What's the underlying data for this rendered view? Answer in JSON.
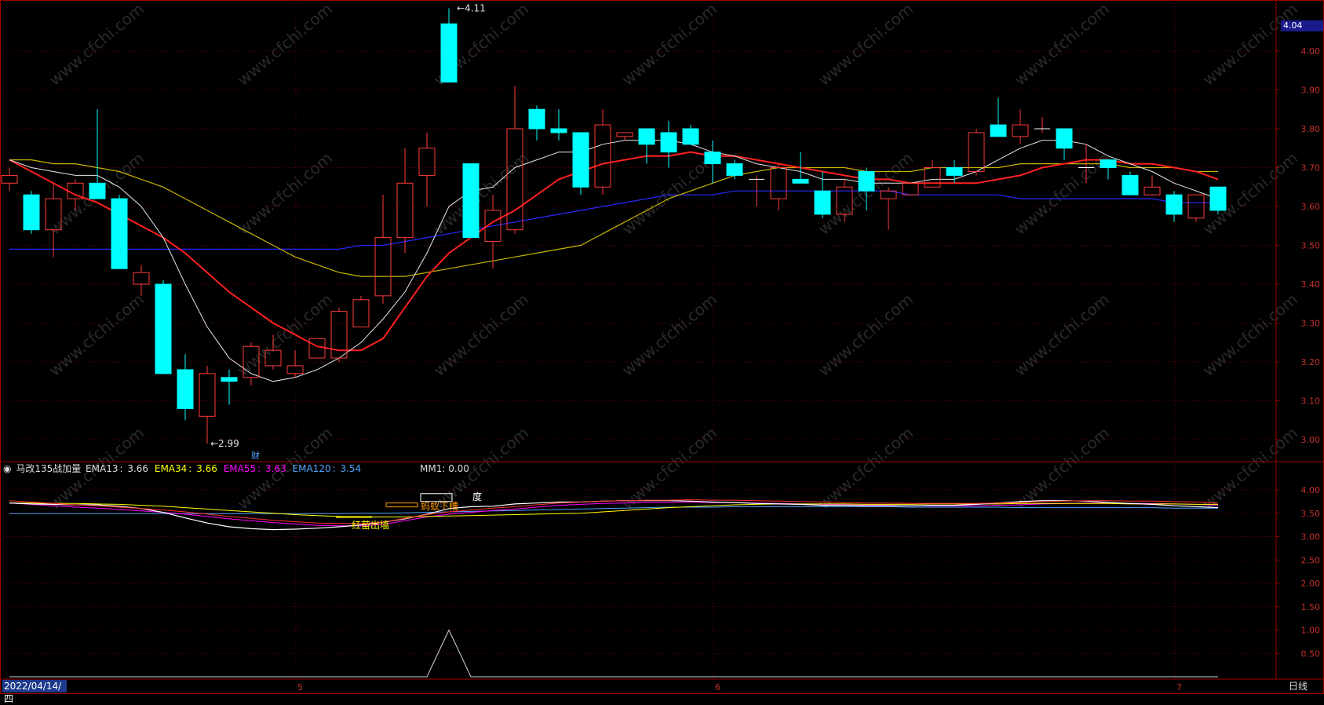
{
  "chart_data": {
    "type": "candlestick",
    "main_panel": {
      "y_ticks": [
        "4.00",
        "3.90",
        "3.80",
        "3.70",
        "3.60",
        "3.50",
        "3.40",
        "3.30",
        "3.20",
        "3.10",
        "3.00"
      ],
      "ylim": [
        2.95,
        4.12
      ],
      "current_price_tag": "4.04",
      "high_label": "4.11",
      "low_label": "2.99",
      "marker_label": "财",
      "candles": [
        {
          "o": 3.66,
          "h": 3.7,
          "l": 3.64,
          "c": 3.68
        },
        {
          "o": 3.63,
          "h": 3.64,
          "l": 3.53,
          "c": 3.54
        },
        {
          "o": 3.54,
          "h": 3.66,
          "l": 3.47,
          "c": 3.62
        },
        {
          "o": 3.62,
          "h": 3.67,
          "l": 3.59,
          "c": 3.66
        },
        {
          "o": 3.66,
          "h": 3.85,
          "l": 3.62,
          "c": 3.62
        },
        {
          "o": 3.62,
          "h": 3.63,
          "l": 3.44,
          "c": 3.44
        },
        {
          "o": 3.4,
          "h": 3.45,
          "l": 3.37,
          "c": 3.43
        },
        {
          "o": 3.4,
          "h": 3.41,
          "l": 3.17,
          "c": 3.17
        },
        {
          "o": 3.18,
          "h": 3.22,
          "l": 3.05,
          "c": 3.08
        },
        {
          "o": 3.06,
          "h": 3.19,
          "l": 2.99,
          "c": 3.17
        },
        {
          "o": 3.16,
          "h": 3.18,
          "l": 3.09,
          "c": 3.15
        },
        {
          "o": 3.16,
          "h": 3.25,
          "l": 3.14,
          "c": 3.24
        },
        {
          "o": 3.19,
          "h": 3.27,
          "l": 3.18,
          "c": 3.23
        },
        {
          "o": 3.17,
          "h": 3.23,
          "l": 3.16,
          "c": 3.19
        },
        {
          "o": 3.21,
          "h": 3.26,
          "l": 3.21,
          "c": 3.26
        },
        {
          "o": 3.21,
          "h": 3.34,
          "l": 3.2,
          "c": 3.33
        },
        {
          "o": 3.29,
          "h": 3.37,
          "l": 3.29,
          "c": 3.36
        },
        {
          "o": 3.37,
          "h": 3.63,
          "l": 3.35,
          "c": 3.52
        },
        {
          "o": 3.52,
          "h": 3.75,
          "l": 3.48,
          "c": 3.66
        },
        {
          "o": 3.68,
          "h": 3.79,
          "l": 3.6,
          "c": 3.75
        },
        {
          "o": 4.07,
          "h": 4.11,
          "l": 3.92,
          "c": 3.92
        },
        {
          "o": 3.71,
          "h": 3.71,
          "l": 3.52,
          "c": 3.52
        },
        {
          "o": 3.51,
          "h": 3.63,
          "l": 3.44,
          "c": 3.59
        },
        {
          "o": 3.54,
          "h": 3.91,
          "l": 3.53,
          "c": 3.8
        },
        {
          "o": 3.85,
          "h": 3.86,
          "l": 3.77,
          "c": 3.8
        },
        {
          "o": 3.8,
          "h": 3.85,
          "l": 3.77,
          "c": 3.79
        },
        {
          "o": 3.79,
          "h": 3.79,
          "l": 3.63,
          "c": 3.65
        },
        {
          "o": 3.65,
          "h": 3.85,
          "l": 3.63,
          "c": 3.81
        },
        {
          "o": 3.78,
          "h": 3.79,
          "l": 3.77,
          "c": 3.79
        },
        {
          "o": 3.8,
          "h": 3.8,
          "l": 3.71,
          "c": 3.76
        },
        {
          "o": 3.79,
          "h": 3.82,
          "l": 3.7,
          "c": 3.74
        },
        {
          "o": 3.8,
          "h": 3.81,
          "l": 3.77,
          "c": 3.76
        },
        {
          "o": 3.74,
          "h": 3.77,
          "l": 3.66,
          "c": 3.71
        },
        {
          "o": 3.71,
          "h": 3.72,
          "l": 3.67,
          "c": 3.68
        },
        {
          "o": 3.67,
          "h": 3.68,
          "l": 3.6,
          "c": 3.67
        },
        {
          "o": 3.62,
          "h": 3.71,
          "l": 3.59,
          "c": 3.7
        },
        {
          "o": 3.67,
          "h": 3.74,
          "l": 3.66,
          "c": 3.66
        },
        {
          "o": 3.64,
          "h": 3.69,
          "l": 3.57,
          "c": 3.58
        },
        {
          "o": 3.58,
          "h": 3.67,
          "l": 3.56,
          "c": 3.65
        },
        {
          "o": 3.69,
          "h": 3.7,
          "l": 3.59,
          "c": 3.64
        },
        {
          "o": 3.62,
          "h": 3.65,
          "l": 3.54,
          "c": 3.64
        },
        {
          "o": 3.63,
          "h": 3.66,
          "l": 3.63,
          "c": 3.66
        },
        {
          "o": 3.65,
          "h": 3.72,
          "l": 3.65,
          "c": 3.7
        },
        {
          "o": 3.7,
          "h": 3.72,
          "l": 3.66,
          "c": 3.68
        },
        {
          "o": 3.69,
          "h": 3.8,
          "l": 3.68,
          "c": 3.79
        },
        {
          "o": 3.81,
          "h": 3.88,
          "l": 3.78,
          "c": 3.78
        },
        {
          "o": 3.78,
          "h": 3.85,
          "l": 3.76,
          "c": 3.81
        },
        {
          "o": 3.8,
          "h": 3.83,
          "l": 3.79,
          "c": 3.8
        },
        {
          "o": 3.8,
          "h": 3.8,
          "l": 3.72,
          "c": 3.75
        },
        {
          "o": 3.7,
          "h": 3.76,
          "l": 3.66,
          "c": 3.7
        },
        {
          "o": 3.72,
          "h": 3.72,
          "l": 3.67,
          "c": 3.7
        },
        {
          "o": 3.68,
          "h": 3.69,
          "l": 3.63,
          "c": 3.63
        },
        {
          "o": 3.63,
          "h": 3.68,
          "l": 3.63,
          "c": 3.65
        },
        {
          "o": 3.63,
          "h": 3.64,
          "l": 3.56,
          "c": 3.58
        },
        {
          "o": 3.57,
          "h": 3.63,
          "l": 3.56,
          "c": 3.63
        },
        {
          "o": 3.65,
          "h": 3.65,
          "l": 3.58,
          "c": 3.59
        }
      ],
      "ema13": [
        3.72,
        3.7,
        3.69,
        3.68,
        3.68,
        3.65,
        3.6,
        3.52,
        3.4,
        3.29,
        3.21,
        3.17,
        3.15,
        3.16,
        3.18,
        3.21,
        3.25,
        3.31,
        3.38,
        3.48,
        3.6,
        3.64,
        3.65,
        3.7,
        3.72,
        3.74,
        3.74,
        3.76,
        3.77,
        3.77,
        3.77,
        3.76,
        3.74,
        3.73,
        3.71,
        3.7,
        3.69,
        3.67,
        3.67,
        3.66,
        3.66,
        3.66,
        3.67,
        3.67,
        3.69,
        3.72,
        3.75,
        3.77,
        3.77,
        3.76,
        3.73,
        3.71,
        3.69,
        3.66,
        3.64,
        3.62
      ],
      "ema34": [
        3.72,
        3.72,
        3.71,
        3.71,
        3.7,
        3.69,
        3.67,
        3.65,
        3.62,
        3.59,
        3.56,
        3.53,
        3.5,
        3.47,
        3.45,
        3.43,
        3.42,
        3.42,
        3.42,
        3.43,
        3.44,
        3.45,
        3.46,
        3.47,
        3.48,
        3.49,
        3.5,
        3.53,
        3.56,
        3.59,
        3.62,
        3.64,
        3.66,
        3.68,
        3.69,
        3.7,
        3.7,
        3.7,
        3.7,
        3.69,
        3.69,
        3.69,
        3.7,
        3.7,
        3.7,
        3.7,
        3.71,
        3.71,
        3.71,
        3.71,
        3.71,
        3.7,
        3.7,
        3.7,
        3.69,
        3.69
      ],
      "ema55": [
        3.72,
        3.69,
        3.66,
        3.63,
        3.61,
        3.58,
        3.55,
        3.52,
        3.48,
        3.43,
        3.38,
        3.34,
        3.3,
        3.27,
        3.24,
        3.23,
        3.23,
        3.26,
        3.34,
        3.42,
        3.48,
        3.52,
        3.56,
        3.59,
        3.63,
        3.67,
        3.69,
        3.71,
        3.72,
        3.73,
        3.73,
        3.74,
        3.73,
        3.73,
        3.72,
        3.71,
        3.7,
        3.69,
        3.68,
        3.67,
        3.67,
        3.66,
        3.66,
        3.66,
        3.66,
        3.67,
        3.68,
        3.7,
        3.71,
        3.72,
        3.72,
        3.71,
        3.71,
        3.7,
        3.69,
        3.67
      ],
      "ema120": [
        3.49,
        3.49,
        3.49,
        3.49,
        3.49,
        3.49,
        3.49,
        3.49,
        3.49,
        3.49,
        3.49,
        3.49,
        3.49,
        3.49,
        3.49,
        3.49,
        3.5,
        3.5,
        3.51,
        3.52,
        3.53,
        3.54,
        3.55,
        3.56,
        3.57,
        3.58,
        3.59,
        3.6,
        3.61,
        3.62,
        3.63,
        3.63,
        3.63,
        3.64,
        3.64,
        3.64,
        3.64,
        3.64,
        3.64,
        3.64,
        3.64,
        3.63,
        3.63,
        3.63,
        3.63,
        3.63,
        3.62,
        3.62,
        3.62,
        3.62,
        3.62,
        3.62,
        3.62,
        3.61,
        3.61,
        3.61
      ]
    },
    "indicator_panel": {
      "title": "马改135战加量",
      "legend": [
        {
          "name": "EMA13",
          "value": "3.66",
          "color": "#ffffff"
        },
        {
          "name": "EMA34",
          "value": "3.66",
          "color": "#ffff00"
        },
        {
          "name": "EMA55",
          "value": "3.63",
          "color": "#ff00ff"
        },
        {
          "name": "EMA120",
          "value": "3.54",
          "color": "#4fa4ff"
        }
      ],
      "mm1_label": "MM1: 0.00",
      "y_ticks": [
        "4.00",
        "3.50",
        "3.00",
        "2.50",
        "2.00",
        "1.50",
        "1.00",
        "0.50"
      ],
      "ylim": [
        0.0,
        4.35
      ],
      "annotations": [
        {
          "text": "红苗出墙",
          "color": "#ffff00",
          "at": 16
        },
        {
          "text": "蚂蚁下槽",
          "color": "#ff9900",
          "at": 19
        },
        {
          "text": "度",
          "color": "#ffffff",
          "at": 20
        }
      ],
      "mm1_values": [
        0,
        0,
        0,
        0,
        0,
        0,
        0,
        0,
        0,
        0,
        0,
        0,
        0,
        0,
        0,
        0,
        0,
        0,
        0,
        0,
        1.0,
        0,
        0,
        0,
        0,
        0,
        0,
        0,
        0,
        0,
        0,
        0,
        0,
        0,
        0,
        0,
        0,
        0,
        0,
        0,
        0,
        0,
        0,
        0,
        0,
        0,
        0,
        0,
        0,
        0,
        0,
        0,
        0,
        0,
        0,
        0
      ]
    },
    "x_axis": {
      "date_label": "2022/04/14/四",
      "month_marks": [
        {
          "label": "5",
          "at": 13
        },
        {
          "label": "6",
          "at": 32
        },
        {
          "label": "7",
          "at": 53
        }
      ],
      "period_label": "日线"
    }
  },
  "watermark": "www.cfchi.com",
  "colors": {
    "up": "#ff3b3b",
    "down": "#00ffff",
    "ema13": "#ffffff",
    "ema34": "#ffff00",
    "ema55": "#ff2020",
    "ema120": "#2828ff",
    "axis": "#a00000"
  }
}
